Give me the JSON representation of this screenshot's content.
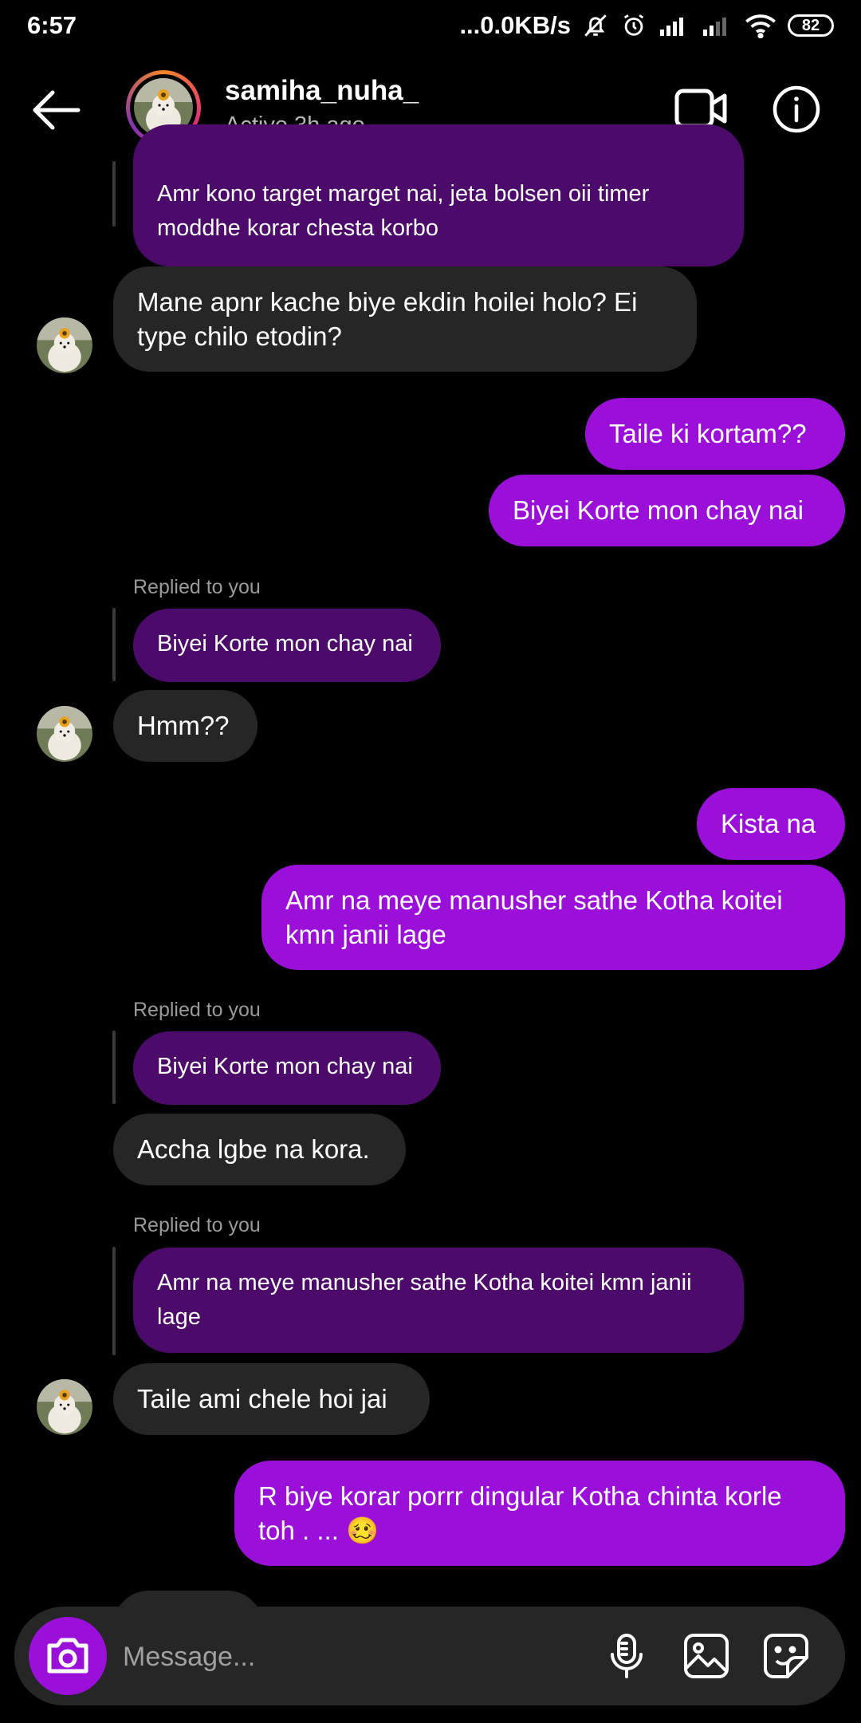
{
  "status_bar": {
    "time": "6:57",
    "network_speed": "...0.0KB/s",
    "battery": "82"
  },
  "header": {
    "username": "samiha_nuha_",
    "status": "Active 3h ago"
  },
  "messages": {
    "q0": "Amr kono target marget nai, jeta bolsen oii timer moddhe korar chesta korbo",
    "m1": "Mane apnr kache biye ekdin hoilei holo? Ei type chilo etodin?",
    "m2": "Taile ki kortam??",
    "m3": "Biyei Korte mon chay nai",
    "r1_label": "Replied to you",
    "r1_quote": "Biyei Korte mon chay nai",
    "m4": "Hmm??",
    "m5": "Kista na",
    "m6": "Amr na meye manusher sathe Kotha koitei kmn janii lage",
    "r2_label": "Replied to you",
    "r2_quote": "Biyei Korte mon chay nai",
    "m7": "Accha lgbe na kora.",
    "r3_label": "Replied to you",
    "r3_quote": "Amr na meye manusher sathe Kotha koitei kmn janii lage",
    "m8": "Taile ami chele hoi jai",
    "m9": "R biye korar porrr dingular Kotha chinta korle toh . ... 🥴"
  },
  "composer": {
    "placeholder": "Message..."
  },
  "colors": {
    "outgoing_bubble": "#9b10d8",
    "incoming_bubble": "#262626",
    "quote_bubble": "#4c0a6b",
    "background": "#000000"
  },
  "icons": {
    "back": "arrow-left-icon",
    "video": "video-call-icon",
    "info": "info-icon",
    "camera": "camera-icon",
    "mic": "microphone-icon",
    "gallery": "gallery-icon",
    "sticker": "sticker-icon"
  }
}
